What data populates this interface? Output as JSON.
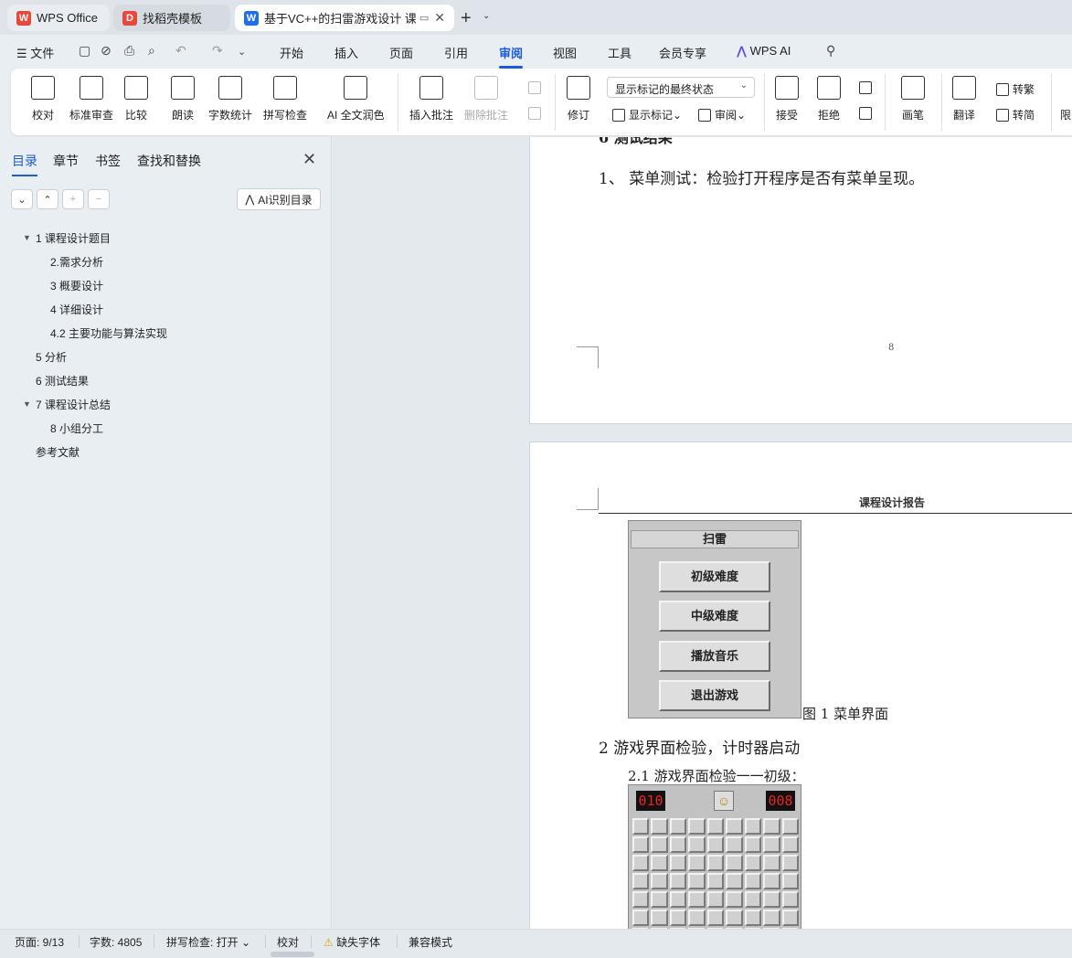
{
  "tabs": [
    {
      "label": "WPS Office",
      "color": "#e8473a"
    },
    {
      "label": "找稻壳模板",
      "color": "#e8473a"
    },
    {
      "label": "基于VC++的扫雷游戏设计 课",
      "color": "#1f6fe8"
    }
  ],
  "menu": {
    "file": "文件",
    "items": [
      "开始",
      "插入",
      "页面",
      "引用",
      "审阅",
      "视图",
      "工具",
      "会员专享"
    ],
    "active": "审阅",
    "ai": "WPS AI"
  },
  "ribbon": {
    "proofread": "校对",
    "standard_review": "标准审查",
    "compare": "比较",
    "read_aloud": "朗读",
    "word_count": "字数统计",
    "spell_check": "拼写检查",
    "ai_polish": "AI 全文润色",
    "insert_comment": "插入批注",
    "delete_comment": "删除批注",
    "track": "修订",
    "markup_state": "显示标记的最终状态",
    "show_markup": "显示标记",
    "review": "审阅",
    "accept": "接受",
    "reject": "拒绝",
    "pen": "画笔",
    "translate": "翻译",
    "to_traditional": "转繁",
    "to_simplified": "转简",
    "limit": "限"
  },
  "nav": {
    "tabs": [
      "目录",
      "章节",
      "书签",
      "查找和替换"
    ],
    "ai_toc": "AI识别目录",
    "toc": [
      {
        "text": "1  课程设计题目",
        "level": 1,
        "expanded": true
      },
      {
        "text": "2.需求分析",
        "level": 2
      },
      {
        "text": "3  概要设计",
        "level": 2
      },
      {
        "text": "4 详细设计",
        "level": 2
      },
      {
        "text": "4.2  主要功能与算法实现",
        "level": 2
      },
      {
        "text": "5  分析",
        "level": 1
      },
      {
        "text": "6  测试结果",
        "level": 1
      },
      {
        "text": "7    课程设计总结",
        "level": 1,
        "expanded": true
      },
      {
        "text": "8  小组分工",
        "level": 2
      },
      {
        "text": "参考文献",
        "level": 1
      }
    ]
  },
  "doc": {
    "page1_line": "1、  菜单测试：检验打开程序是否有菜单呈现。",
    "page1_heading_partial": "6  测试结果",
    "page_number": "8",
    "header": "课程设计报告",
    "menu_title": "扫雷",
    "menu_buttons": [
      "初级难度",
      "中级难度",
      "播放音乐",
      "退出游戏"
    ],
    "figure_caption": "图 1  菜单界面",
    "section2": "2 游戏界面检验，计时器启动",
    "section21": "2.1 游戏界面检验一一初级：",
    "counter_left": "010",
    "counter_right": "008",
    "smiley": "☺"
  },
  "status": {
    "page": "页面: 9/13",
    "words": "字数: 4805",
    "spell": "拼写检查: 打开",
    "proof": "校对",
    "missing_font": "缺失字体",
    "compat": "兼容模式"
  }
}
